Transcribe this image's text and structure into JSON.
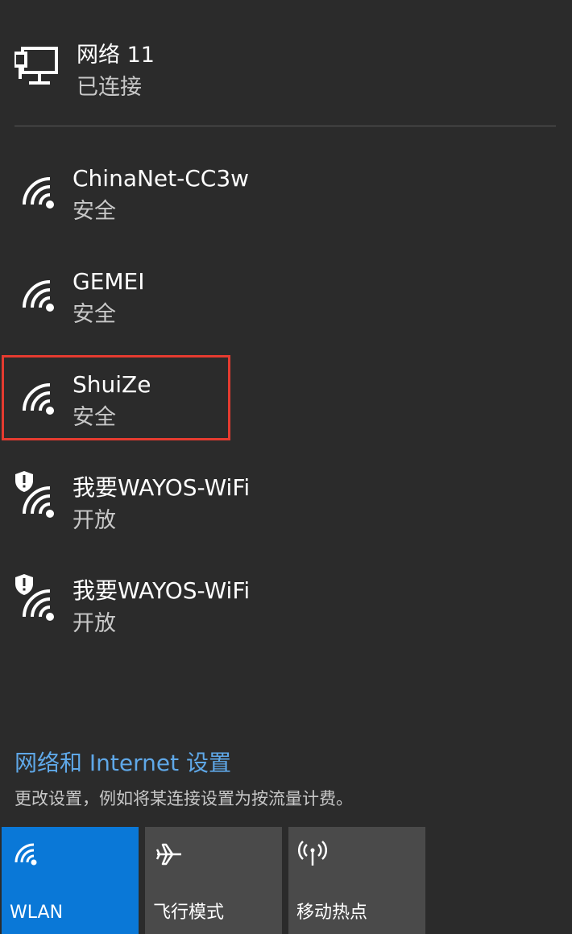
{
  "wired": {
    "title": "网络 11",
    "status": "已连接",
    "icon": "monitor-network-icon"
  },
  "networks": [
    {
      "name": "ChinaNet-CC3w",
      "security": "安全",
      "icon": "wifi-signal-icon"
    },
    {
      "name": "GEMEI",
      "security": "安全",
      "icon": "wifi-signal-icon"
    },
    {
      "name": "ShuiZe",
      "security": "安全",
      "icon": "wifi-signal-icon"
    },
    {
      "name": "我要WAYOS-WiFi",
      "security": "开放",
      "icon": "wifi-warning-icon"
    },
    {
      "name": "我要WAYOS-WiFi",
      "security": "开放",
      "icon": "wifi-warning-icon"
    }
  ],
  "settings": {
    "link_label": "网络和 Internet 设置",
    "description": "更改设置，例如将某连接设置为按流量计费。"
  },
  "quick_actions": [
    {
      "label": "WLAN",
      "icon": "wifi-icon",
      "active": true
    },
    {
      "label": "飞行模式",
      "icon": "airplane-icon",
      "active": false
    },
    {
      "label": "移动热点",
      "icon": "hotspot-icon",
      "active": false
    }
  ],
  "colors": {
    "background": "#2b2b2b",
    "accent": "#0a78d7",
    "link": "#5fa8e8",
    "highlight": "#e53b30"
  }
}
